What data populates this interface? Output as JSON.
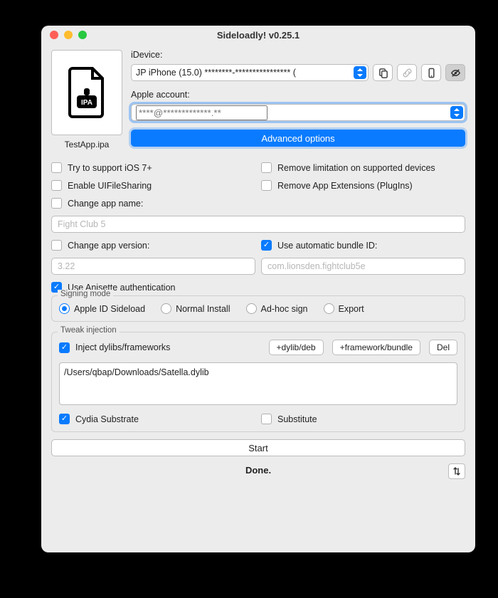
{
  "window": {
    "title": "Sideloadly! v0.25.1"
  },
  "ipa": {
    "filename": "TestApp.ipa"
  },
  "idevice": {
    "label": "iDevice:",
    "value": "JP iPhone (15.0) ********-**************** ("
  },
  "apple_account": {
    "label": "Apple account:",
    "placeholder": "****@*************.**"
  },
  "advanced_label": "Advanced options",
  "options": {
    "ios7": {
      "label": "Try to support iOS 7+",
      "checked": false
    },
    "remove_limit": {
      "label": "Remove limitation on supported devices",
      "checked": false
    },
    "uifs": {
      "label": "Enable UIFileSharing",
      "checked": false
    },
    "remove_ext": {
      "label": "Remove App Extensions (PlugIns)",
      "checked": false
    },
    "change_name": {
      "label": "Change app name:",
      "checked": false,
      "value": "Fight Club 5"
    },
    "change_ver": {
      "label": "Change app version:",
      "checked": false,
      "value": "3.22"
    },
    "auto_bundle": {
      "label": "Use automatic bundle ID:",
      "checked": true,
      "value": "com.lionsden.fightclub5e"
    },
    "anisette": {
      "label": "Use Anisette authentication",
      "checked": true
    }
  },
  "signing": {
    "legend": "Signing mode",
    "modes": [
      "Apple ID Sideload",
      "Normal Install",
      "Ad-hoc sign",
      "Export"
    ],
    "selected": 0
  },
  "tweak": {
    "legend": "Tweak injection",
    "inject": {
      "label": "Inject dylibs/frameworks",
      "checked": true
    },
    "buttons": {
      "dylib": "+dylib/deb",
      "framework": "+framework/bundle",
      "del": "Del"
    },
    "list": "/Users/qbap/Downloads/Satella.dylib",
    "cydia": {
      "label": "Cydia Substrate",
      "checked": true
    },
    "substitute": {
      "label": "Substitute",
      "checked": false
    }
  },
  "start_label": "Start",
  "status": "Done."
}
